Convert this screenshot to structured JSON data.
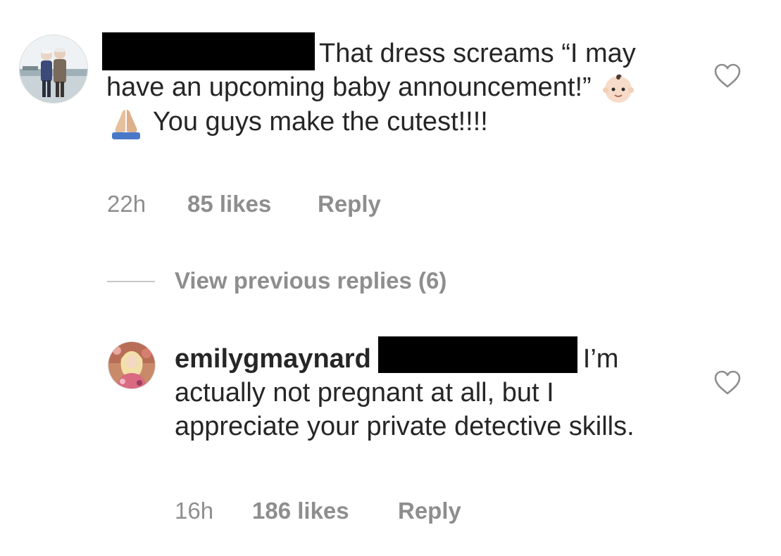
{
  "comments": [
    {
      "before_text": "",
      "body_text": "That dress screams “I may have an upcoming baby announcement!” ",
      "body_text_after_emoji": " You guys make the cutest!!!!",
      "emojis": [
        "baby-emoji",
        "folded-hands-emoji"
      ],
      "time": "22h",
      "likes": "85 likes",
      "reply": "Reply"
    },
    {
      "username": "emilygmaynard",
      "body_text": "I’m actually not pregnant at all, but I appreciate your private detective skills.",
      "time": "16h",
      "likes": "186 likes",
      "reply": "Reply"
    }
  ],
  "view_previous_replies": "View previous replies (6)",
  "colors": {
    "text": "#262626",
    "meta": "#8e8e8e",
    "redaction": "#000000",
    "divider": "#c7c7c7"
  },
  "icons": [
    "heart-outline-icon",
    "heart-outline-icon"
  ]
}
